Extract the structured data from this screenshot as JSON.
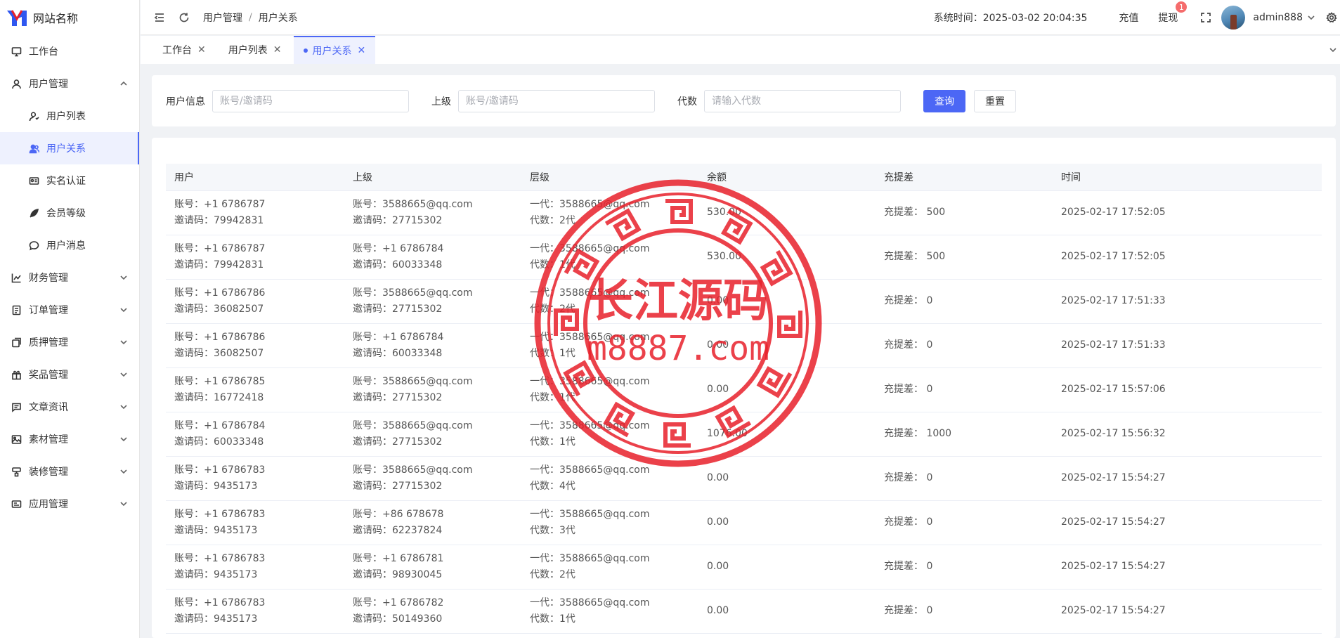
{
  "site": {
    "name": "网站名称"
  },
  "sidebar": {
    "items": [
      {
        "label": "工作台",
        "icon": "monitor-icon",
        "level": 1,
        "active": false,
        "expandable": false
      },
      {
        "label": "用户管理",
        "icon": "user-icon",
        "level": 1,
        "active": false,
        "expandable": true,
        "expanded": true
      },
      {
        "label": "用户列表",
        "icon": "user-list-icon",
        "level": 2,
        "active": false
      },
      {
        "label": "用户关系",
        "icon": "user-relation-icon",
        "level": 2,
        "active": true
      },
      {
        "label": "实名认证",
        "icon": "id-card-icon",
        "level": 2,
        "active": false
      },
      {
        "label": "会员等级",
        "icon": "rocket-icon",
        "level": 2,
        "active": false
      },
      {
        "label": "用户消息",
        "icon": "message-icon",
        "level": 2,
        "active": false
      },
      {
        "label": "财务管理",
        "icon": "chart-icon",
        "level": 1,
        "expandable": true
      },
      {
        "label": "订单管理",
        "icon": "order-icon",
        "level": 1,
        "expandable": true
      },
      {
        "label": "质押管理",
        "icon": "pledge-icon",
        "level": 1,
        "expandable": true
      },
      {
        "label": "奖品管理",
        "icon": "gift-icon",
        "level": 1,
        "expandable": true
      },
      {
        "label": "文章资讯",
        "icon": "article-icon",
        "level": 1,
        "expandable": true
      },
      {
        "label": "素材管理",
        "icon": "image-icon",
        "level": 1,
        "expandable": true
      },
      {
        "label": "装修管理",
        "icon": "decor-icon",
        "level": 1,
        "expandable": true
      },
      {
        "label": "应用管理",
        "icon": "app-icon",
        "level": 1,
        "expandable": true
      }
    ]
  },
  "header": {
    "breadcrumb": [
      "用户管理",
      "用户关系"
    ],
    "sys_time_label": "系统时间：",
    "sys_time": "2025-03-02 20:04:35",
    "recharge": "充值",
    "withdraw": "提现",
    "withdraw_badge": "1",
    "username": "admin888"
  },
  "tabs": [
    {
      "label": "工作台",
      "active": false
    },
    {
      "label": "用户列表",
      "active": false
    },
    {
      "label": "用户关系",
      "active": true
    }
  ],
  "search": {
    "user_info_label": "用户信息",
    "user_info_placeholder": "账号/邀请码",
    "parent_label": "上级",
    "parent_placeholder": "账号/邀请码",
    "gen_label": "代数",
    "gen_placeholder": "请输入代数",
    "query_button": "查询",
    "reset_button": "重置"
  },
  "table": {
    "columns": [
      "用户",
      "上级",
      "层级",
      "余额",
      "充提差",
      "时间"
    ],
    "rows": [
      {
        "user_account": "账号：+1 6786787",
        "user_code": "邀请码：79942831",
        "parent_account": "账号：3588665@qq.com",
        "parent_code": "邀请码：27715302",
        "level_first": "一代：3588665@qq.com",
        "level_gen": "代数：2代",
        "balance": "530.00",
        "diff": "充提差：  500",
        "time": "2025-02-17 17:52:05"
      },
      {
        "user_account": "账号：+1 6786787",
        "user_code": "邀请码：79942831",
        "parent_account": "账号：+1 6786784",
        "parent_code": "邀请码：60033348",
        "level_first": "一代：3588665@qq.com",
        "level_gen": "代数：1代",
        "balance": "530.00",
        "diff": "充提差：  500",
        "time": "2025-02-17 17:52:05"
      },
      {
        "user_account": "账号：+1 6786786",
        "user_code": "邀请码：36082507",
        "parent_account": "账号：3588665@qq.com",
        "parent_code": "邀请码：27715302",
        "level_first": "一代：3588665@qq.com",
        "level_gen": "代数：2代",
        "balance": "0.00",
        "diff": "充提差：  0",
        "time": "2025-02-17 17:51:33"
      },
      {
        "user_account": "账号：+1 6786786",
        "user_code": "邀请码：36082507",
        "parent_account": "账号：+1 6786784",
        "parent_code": "邀请码：60033348",
        "level_first": "一代：3588665@qq.com",
        "level_gen": "代数：1代",
        "balance": "0.00",
        "diff": "充提差：  0",
        "time": "2025-02-17 17:51:33"
      },
      {
        "user_account": "账号：+1 6786785",
        "user_code": "邀请码：16772418",
        "parent_account": "账号：3588665@qq.com",
        "parent_code": "邀请码：27715302",
        "level_first": "一代：3588665@qq.com",
        "level_gen": "代数：1代",
        "balance": "0.00",
        "diff": "充提差：  0",
        "time": "2025-02-17 15:57:06"
      },
      {
        "user_account": "账号：+1 6786784",
        "user_code": "邀请码：60033348",
        "parent_account": "账号：3588665@qq.com",
        "parent_code": "邀请码：27715302",
        "level_first": "一代：3588665@qq.com",
        "level_gen": "代数：1代",
        "balance": "1076.00",
        "diff": "充提差：  1000",
        "time": "2025-02-17 15:56:32"
      },
      {
        "user_account": "账号：+1 6786783",
        "user_code": "邀请码：9435173",
        "parent_account": "账号：3588665@qq.com",
        "parent_code": "邀请码：27715302",
        "level_first": "一代：3588665@qq.com",
        "level_gen": "代数：4代",
        "balance": "0.00",
        "diff": "充提差：  0",
        "time": "2025-02-17 15:54:27"
      },
      {
        "user_account": "账号：+1 6786783",
        "user_code": "邀请码：9435173",
        "parent_account": "账号：+86 678678",
        "parent_code": "邀请码：62237824",
        "level_first": "一代：3588665@qq.com",
        "level_gen": "代数：3代",
        "balance": "0.00",
        "diff": "充提差：  0",
        "time": "2025-02-17 15:54:27"
      },
      {
        "user_account": "账号：+1 6786783",
        "user_code": "邀请码：9435173",
        "parent_account": "账号：+1 6786781",
        "parent_code": "邀请码：98930045",
        "level_first": "一代：3588665@qq.com",
        "level_gen": "代数：2代",
        "balance": "0.00",
        "diff": "充提差：  0",
        "time": "2025-02-17 15:54:27"
      },
      {
        "user_account": "账号：+1 6786783",
        "user_code": "邀请码：9435173",
        "parent_account": "账号：+1 6786782",
        "parent_code": "邀请码：50149360",
        "level_first": "一代：3588665@qq.com",
        "level_gen": "代数：1代",
        "balance": "0.00",
        "diff": "充提差：  0",
        "time": "2025-02-17 15:54:27"
      }
    ]
  },
  "watermark": {
    "line1": "长江源码",
    "line2": "m8887.com",
    "color": "#e8212b"
  },
  "colors": {
    "accent": "#4c67f5",
    "badge": "#f56c6c"
  }
}
